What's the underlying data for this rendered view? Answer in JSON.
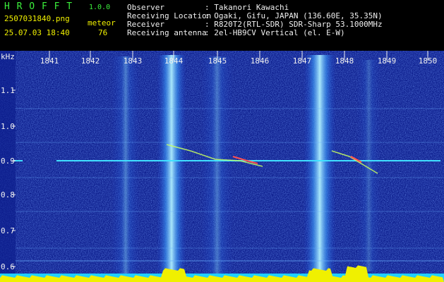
{
  "app": {
    "name": "H R O F F T",
    "version": "1.0.0",
    "filename": "2507031840.png",
    "timestamp": "25.07.03 18:40",
    "count_label": "meteor",
    "count_value": "76"
  },
  "info": {
    "observer_label": "Observer",
    "observer_value": ": Takanori Kawachi",
    "location_label": "Receiving Location",
    "location_value": ": Ogaki, Gifu, JAPAN (136.60E, 35.35N)",
    "receiver_label": "Receiver",
    "receiver_value": ": R820T2(RTL-SDR) SDR-Sharp 53.1000MHz",
    "antenna_label": "Receiving antenna",
    "antenna_value": ": 2el-HB9CV Vertical (el. E-W)"
  },
  "axis": {
    "unit": "kHz",
    "time_ticks": [
      "1841",
      "1842",
      "1843",
      "1844",
      "1845",
      "1846",
      "1847",
      "1848",
      "1849",
      "1850"
    ],
    "freq_ticks": [
      "1.1",
      "1.0",
      "0.9",
      "0.8",
      "0.7",
      "0.6"
    ]
  },
  "colors": {
    "background": "#0a1a8a",
    "header_green": "#3cf03c",
    "header_yellow": "#f0f000",
    "carrier": "#40e0ff",
    "baseline_yellow": "#f0f000",
    "baseline_cyan": "#20d0ff"
  }
}
